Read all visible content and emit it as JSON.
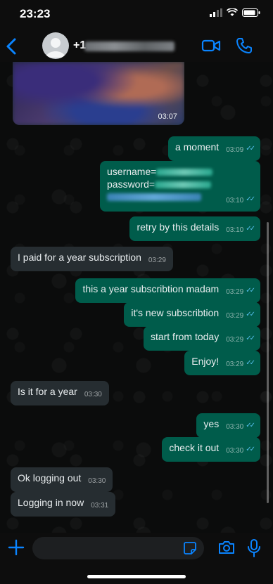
{
  "status_bar": {
    "time": "23:23"
  },
  "header": {
    "contact_prefix": "+1"
  },
  "media": {
    "time": "03:07"
  },
  "messages": [
    {
      "side": "out",
      "text": "a moment",
      "time": "03:09"
    },
    {
      "side": "out",
      "line1": "username=",
      "line2": "password=",
      "time": "03:10"
    },
    {
      "side": "out",
      "text": "retry by this details",
      "time": "03:10"
    },
    {
      "side": "in",
      "text": "I paid for a year subscription",
      "time": "03:29"
    },
    {
      "side": "out",
      "text": "this a year subscribtion madam",
      "time": "03:29"
    },
    {
      "side": "out",
      "text": "it's new subscribtion",
      "time": "03:29"
    },
    {
      "side": "out",
      "text": "start from today",
      "time": "03:29"
    },
    {
      "side": "out",
      "text": "Enjoy!",
      "time": "03:29"
    },
    {
      "side": "in",
      "text": "Is it for a year",
      "time": "03:30"
    },
    {
      "side": "out",
      "text": "yes",
      "time": "03:30"
    },
    {
      "side": "out",
      "text": "check it out",
      "time": "03:30"
    },
    {
      "side": "in",
      "text": "Ok logging out",
      "time": "03:30"
    },
    {
      "side": "in",
      "text": "Logging in now",
      "time": "03:31"
    }
  ],
  "input": {
    "placeholder": ""
  },
  "colors": {
    "accent": "#0a84ff",
    "outgoing_bubble": "#005c4b",
    "incoming_bubble": "#262d31",
    "read_ticks": "#53bdeb"
  },
  "icons": [
    "back-chevron-icon",
    "avatar-icon",
    "video-call-icon",
    "phone-icon",
    "plus-icon",
    "sticker-icon",
    "camera-icon",
    "microphone-icon"
  ]
}
